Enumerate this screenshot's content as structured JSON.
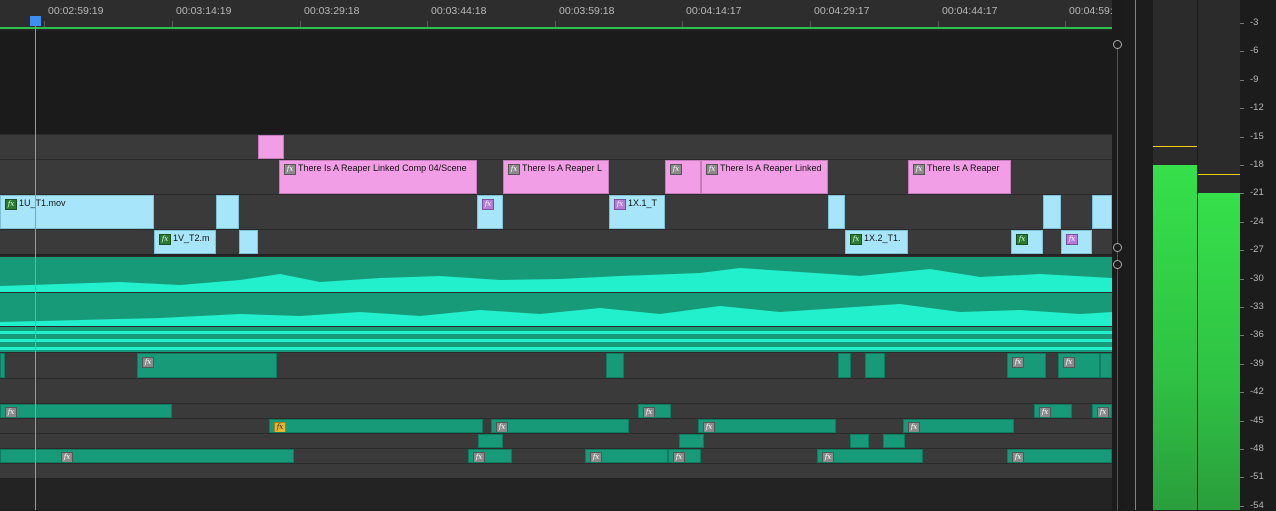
{
  "ruler": {
    "timecodes": [
      "00:02:59:19",
      "00:03:14:19",
      "00:03:29:18",
      "00:03:44:18",
      "00:03:59:18",
      "00:04:14:17",
      "00:04:29:17",
      "00:04:44:17",
      "00:04:59:"
    ]
  },
  "clips": {
    "pink1": "There Is A Reaper Linked Comp 04/Scene",
    "pink2": "There Is A Reaper L",
    "pink3": "There Is A Reaper Linked",
    "pink4": "There Is A Reaper",
    "blue1": "1U_T1.mov",
    "blue2": "1X.1_T",
    "blue3": "1V_T2.m",
    "blue4": "1X.2_T1."
  },
  "fx_icon": "fx",
  "meter": {
    "scale": [
      "-3",
      "-6",
      "-9",
      "-12",
      "-15",
      "-18",
      "-21",
      "-24",
      "-27",
      "-30",
      "-33",
      "-36",
      "-39",
      "-42",
      "-45",
      "-48",
      "-51",
      "-54"
    ],
    "left_level_db": -18,
    "right_level_db": -21,
    "left_peak_db": -17,
    "right_peak_db": -20,
    "colors": {
      "meter_green": "#35e04a",
      "peak": "#f0d000",
      "playhead": "#3d8ef0"
    }
  }
}
